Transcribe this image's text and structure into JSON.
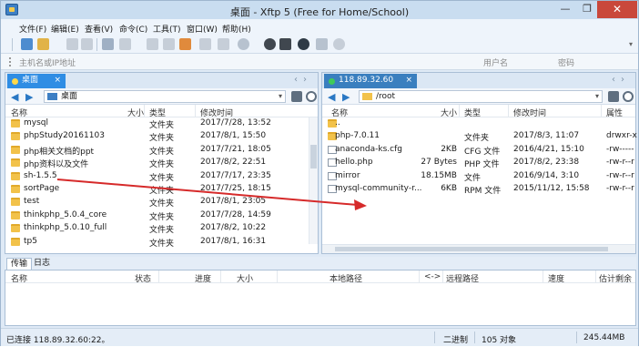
{
  "window": {
    "title": "桌面 - Xftp 5 (Free for Home/School)",
    "minimize": "—",
    "restore": "❐",
    "close": "✕"
  },
  "menu": [
    "文件(F)",
    "编辑(E)",
    "查看(V)",
    "命令(C)",
    "工具(T)",
    "窗口(W)",
    "帮助(H)"
  ],
  "address": {
    "placeholder": "主机名或IP地址",
    "user_placeholder": "用户名",
    "password_placeholder": "密码"
  },
  "left_pane": {
    "tab_label": "桌面",
    "path": "桌面",
    "columns": [
      "名称",
      "大小",
      "类型",
      "修改时间"
    ],
    "rows": [
      {
        "name": "mysql",
        "size": "",
        "type": "文件夹",
        "modified": "2017/7/28, 13:52",
        "kind": "folder"
      },
      {
        "name": "phpStudy20161103",
        "size": "",
        "type": "文件夹",
        "modified": "2017/8/1, 15:50",
        "kind": "folder"
      },
      {
        "name": "php相关文档的ppt",
        "size": "",
        "type": "文件夹",
        "modified": "2017/7/21, 18:05",
        "kind": "folder"
      },
      {
        "name": "php资料以及文件",
        "size": "",
        "type": "文件夹",
        "modified": "2017/8/2, 22:51",
        "kind": "folder"
      },
      {
        "name": "sh-1.5.5",
        "size": "",
        "type": "文件夹",
        "modified": "2017/7/17, 23:35",
        "kind": "folder"
      },
      {
        "name": "sortPage",
        "size": "",
        "type": "文件夹",
        "modified": "2017/7/25, 18:15",
        "kind": "folder"
      },
      {
        "name": "test",
        "size": "",
        "type": "文件夹",
        "modified": "2017/8/1, 23:05",
        "kind": "folder"
      },
      {
        "name": "thinkphp_5.0.4_core",
        "size": "",
        "type": "文件夹",
        "modified": "2017/7/28, 14:59",
        "kind": "folder"
      },
      {
        "name": "thinkphp_5.0.10_full",
        "size": "",
        "type": "文件夹",
        "modified": "2017/8/2, 10:22",
        "kind": "folder"
      },
      {
        "name": "tp5",
        "size": "",
        "type": "文件夹",
        "modified": "2017/8/1, 16:31",
        "kind": "folder"
      }
    ]
  },
  "right_pane": {
    "tab_label": "118.89.32.60",
    "path": "/root",
    "columns": [
      "名称",
      "大小",
      "类型",
      "修改时间",
      "属性"
    ],
    "rows": [
      {
        "name": "..",
        "size": "",
        "type": "",
        "modified": "",
        "attrs": "",
        "kind": "folder"
      },
      {
        "name": "php-7.0.11",
        "size": "",
        "type": "文件夹",
        "modified": "2017/8/3, 11:07",
        "attrs": "drwxr-x",
        "kind": "folder"
      },
      {
        "name": "anaconda-ks.cfg",
        "size": "2KB",
        "type": "CFG 文件",
        "modified": "2016/4/21, 15:10",
        "attrs": "-rw-----",
        "kind": "file"
      },
      {
        "name": "hello.php",
        "size": "27 Bytes",
        "type": "PHP 文件",
        "modified": "2017/8/2, 23:38",
        "attrs": "-rw-r--r",
        "kind": "file"
      },
      {
        "name": "mirror",
        "size": "18.15MB",
        "type": "文件",
        "modified": "2016/9/14, 3:10",
        "attrs": "-rw-r--r",
        "kind": "file"
      },
      {
        "name": "mysql-community-r...",
        "size": "6KB",
        "type": "RPM 文件",
        "modified": "2015/11/12, 15:58",
        "attrs": "-rw-r--r",
        "kind": "file"
      }
    ]
  },
  "bottom_tabs": [
    "传输",
    "日志"
  ],
  "transfer_columns": [
    "名称",
    "状态",
    "进度",
    "大小",
    "本地路径",
    "<->",
    "远程路径",
    "速度",
    "估计剩余"
  ],
  "status": {
    "connection": "已连接 118.89.32.60:22。",
    "mode": "二进制",
    "objects": "105 对象",
    "size": "245.44MB"
  },
  "colors": {
    "accent_blue": "#2f8de4",
    "folder_yellow": "#f2c24a",
    "close_red": "#c9483b",
    "annotation_arrow": "#d62a2a"
  }
}
